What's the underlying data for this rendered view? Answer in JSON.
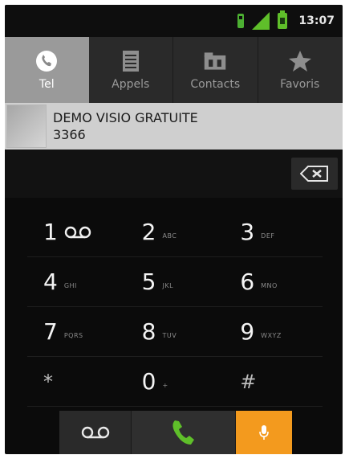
{
  "status": {
    "time": "13:07"
  },
  "tabs": [
    {
      "label": "Tel",
      "icon": "phone-icon",
      "active": true
    },
    {
      "label": "Appels",
      "icon": "call-log-icon",
      "active": false
    },
    {
      "label": "Contacts",
      "icon": "contacts-icon",
      "active": false
    },
    {
      "label": "Favoris",
      "icon": "star-icon",
      "active": false
    }
  ],
  "contact": {
    "name": "DEMO VISIO GRATUITE",
    "number": "3366"
  },
  "dialer": {
    "value": "",
    "keys": [
      {
        "num": "1",
        "letters": "",
        "icon": "voicemail-icon"
      },
      {
        "num": "2",
        "letters": "ABC"
      },
      {
        "num": "3",
        "letters": "DEF"
      },
      {
        "num": "4",
        "letters": "GHI"
      },
      {
        "num": "5",
        "letters": "JKL"
      },
      {
        "num": "6",
        "letters": "MNO"
      },
      {
        "num": "7",
        "letters": "PQRS"
      },
      {
        "num": "8",
        "letters": "TUV"
      },
      {
        "num": "9",
        "letters": "WXYZ"
      },
      {
        "num": "*",
        "letters": ""
      },
      {
        "num": "0",
        "letters": "+"
      },
      {
        "num": "#",
        "letters": ""
      }
    ]
  },
  "colors": {
    "accent_green": "#5fbf2a",
    "accent_orange": "#f39a1e",
    "tab_active": "#9a9a9a"
  }
}
